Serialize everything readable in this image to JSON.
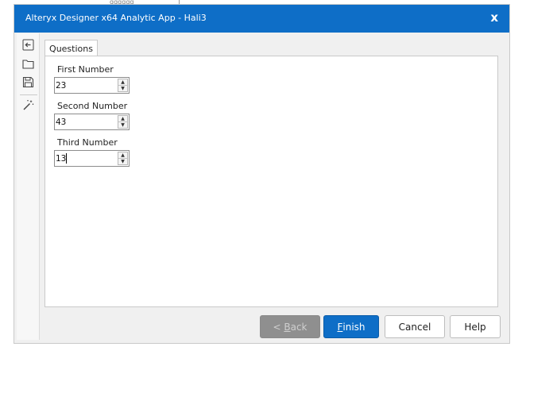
{
  "background": {
    "strip_text": "qqqqqq"
  },
  "window": {
    "title": "Alteryx Designer x64 Analytic App - Hali3",
    "close_glyph": "x",
    "accent_color": "#0e6ec7"
  },
  "toolbar": {
    "items": [
      {
        "icon": "back-arrow-icon"
      },
      {
        "icon": "folder-open-icon"
      },
      {
        "icon": "save-disk-icon"
      },
      {
        "icon": "magic-wand-icon"
      }
    ]
  },
  "tabs": [
    {
      "label": "Questions"
    }
  ],
  "questions": [
    {
      "label": "First Number",
      "value": "23"
    },
    {
      "label": "Second Number",
      "value": "43"
    },
    {
      "label": "Third Number",
      "value": "13"
    }
  ],
  "buttons": {
    "back": {
      "mnemonic_prefix": "< ",
      "mnemonic": "B",
      "rest": "ack"
    },
    "finish": {
      "mnemonic": "F",
      "rest": "inish"
    },
    "cancel": "Cancel",
    "help": "Help"
  }
}
